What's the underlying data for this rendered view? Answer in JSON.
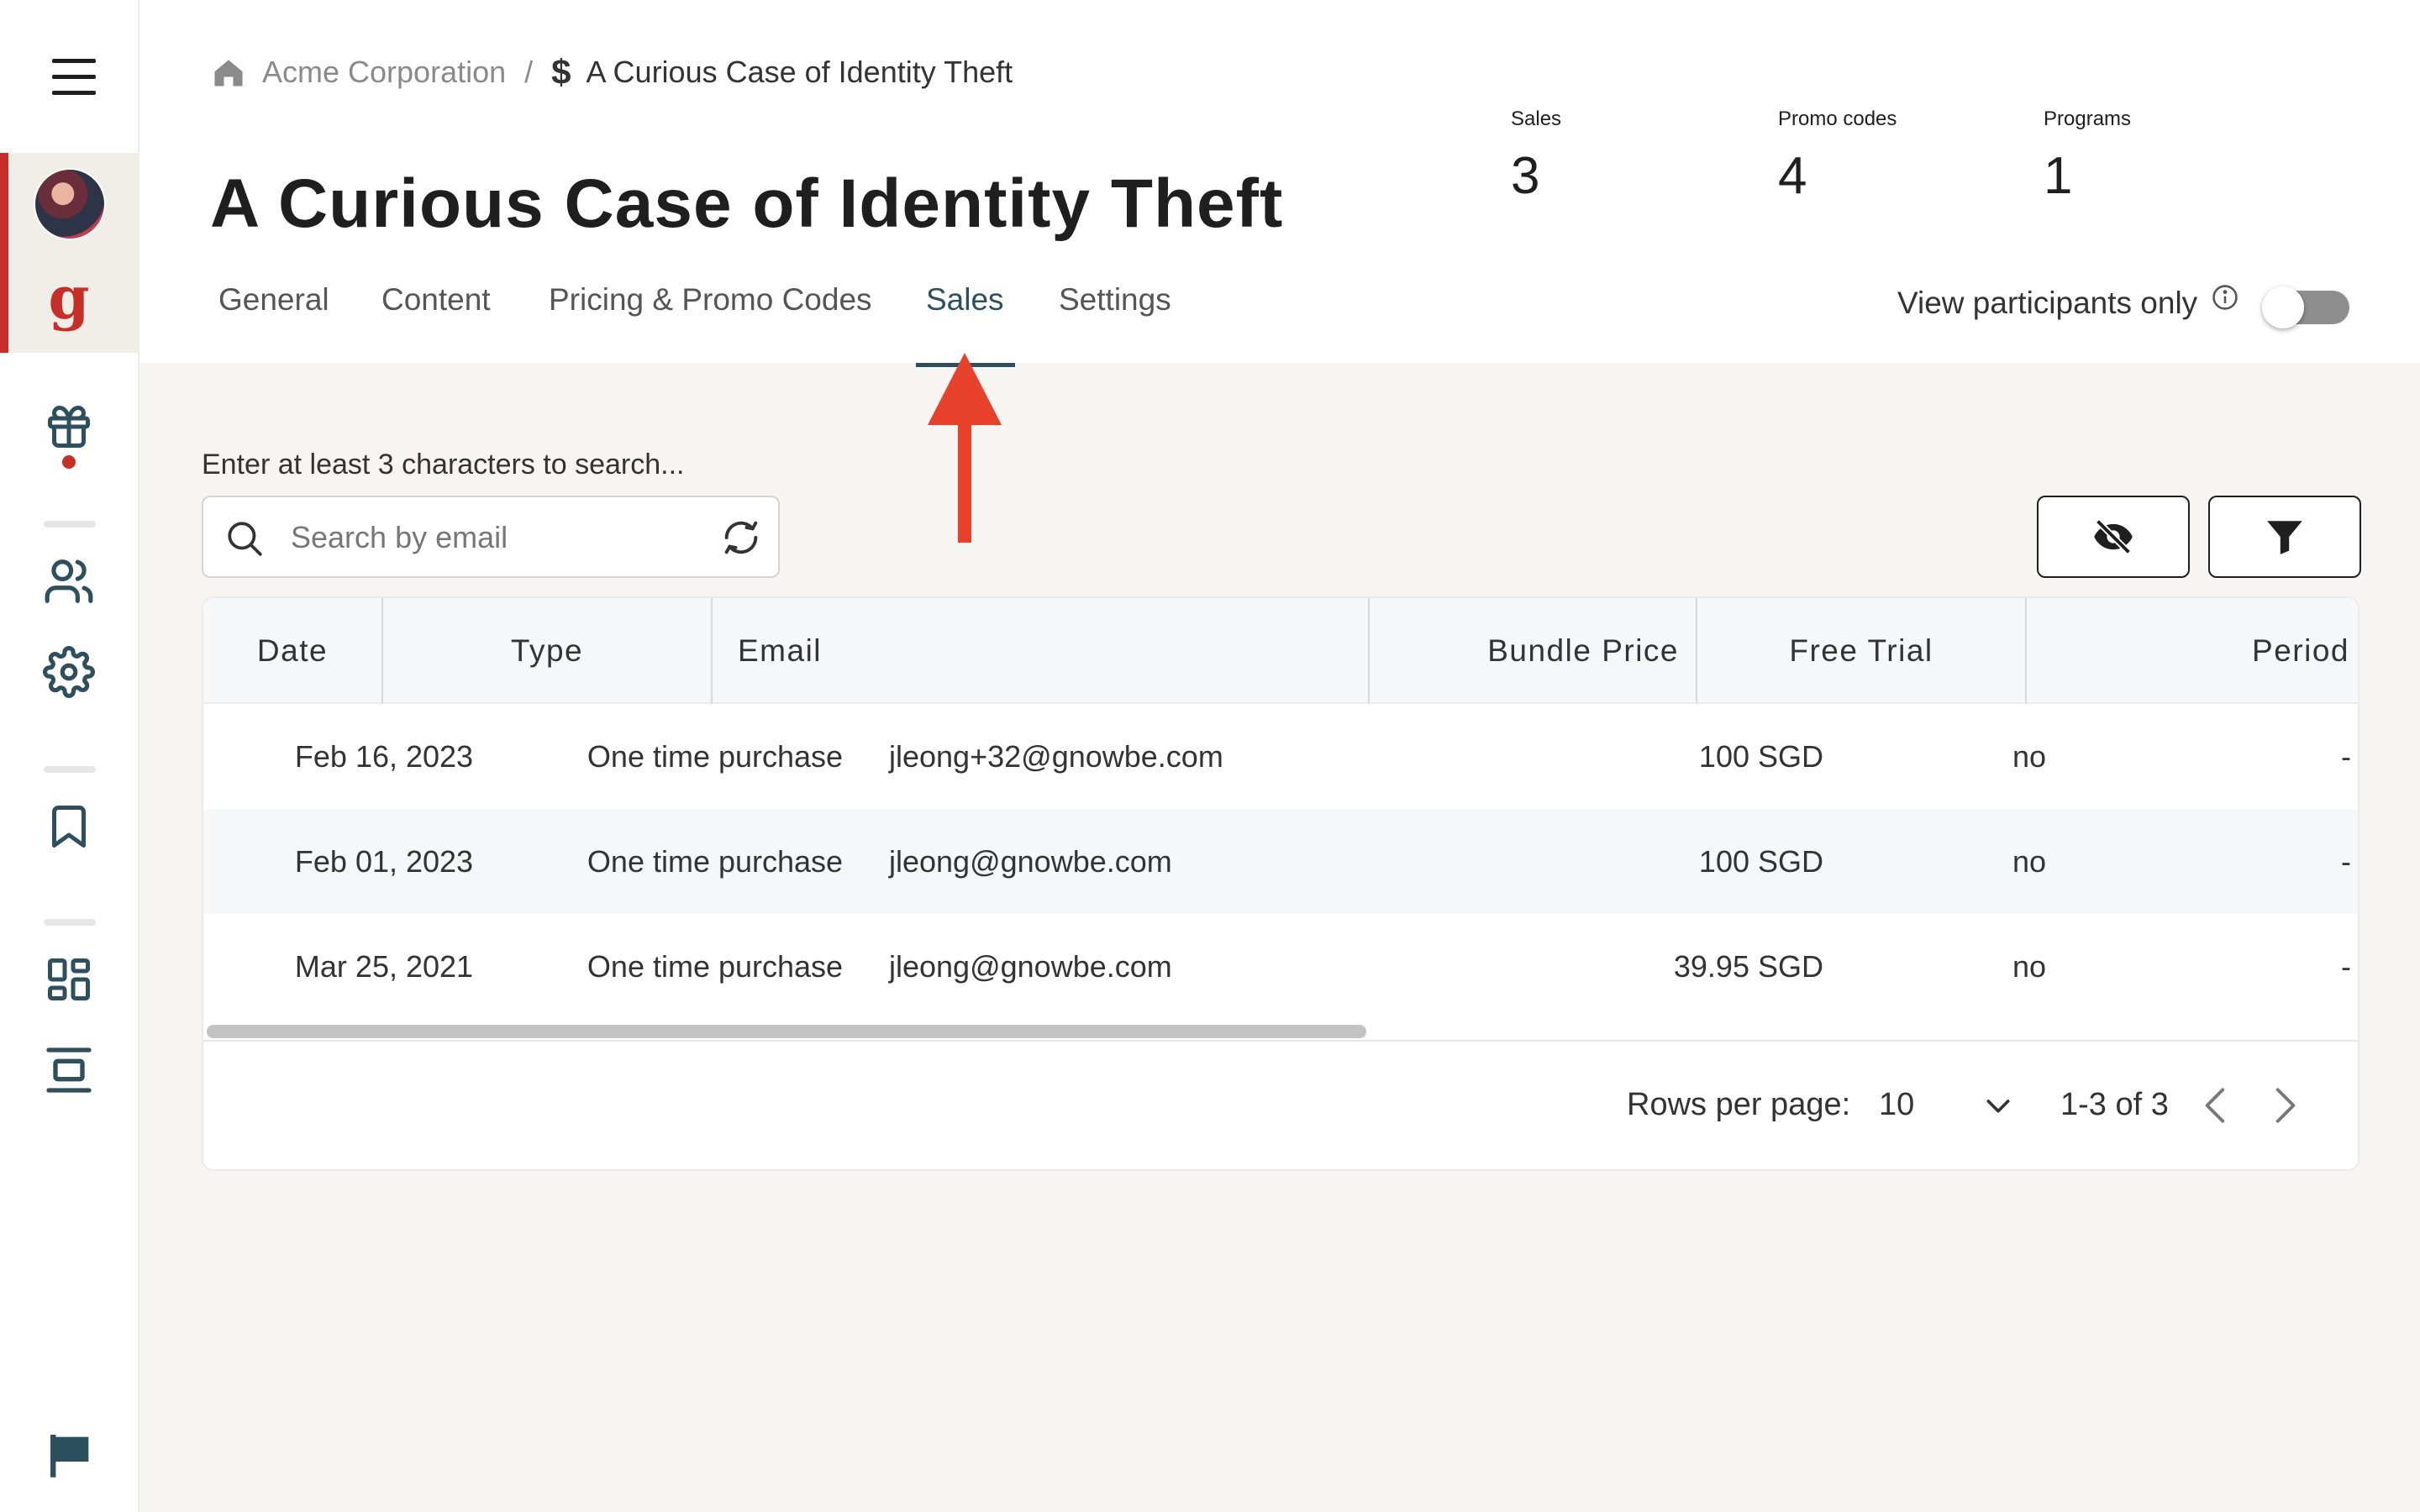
{
  "breadcrumb": {
    "org": "Acme Corporation",
    "separator": "/",
    "dollar": "$",
    "current": "A Curious Case of Identity Theft"
  },
  "page_title": "A Curious Case of Identity Theft",
  "stats": [
    {
      "label": "Sales",
      "value": "3"
    },
    {
      "label": "Promo codes",
      "value": "4"
    },
    {
      "label": "Programs",
      "value": "1"
    }
  ],
  "tabs": [
    {
      "label": "General"
    },
    {
      "label": "Content"
    },
    {
      "label": "Pricing & Promo Codes"
    },
    {
      "label": "Sales",
      "active": true
    },
    {
      "label": "Settings"
    }
  ],
  "participants_toggle": {
    "label": "View participants only",
    "on": false
  },
  "search": {
    "hint": "Enter at least 3 characters to search...",
    "placeholder": "Search by email",
    "value": ""
  },
  "table": {
    "columns": [
      "Date",
      "Type",
      "Email",
      "Bundle Price",
      "Free Trial",
      "Period"
    ],
    "rows": [
      {
        "date": "Feb 16, 2023",
        "type": "One time purchase",
        "email": "jleong+32@gnowbe.com",
        "price": "100 SGD",
        "trial": "no",
        "period": "-"
      },
      {
        "date": "Feb 01, 2023",
        "type": "One time purchase",
        "email": "jleong@gnowbe.com",
        "price": "100 SGD",
        "trial": "no",
        "period": "-"
      },
      {
        "date": "Mar 25, 2021",
        "type": "One time purchase",
        "email": "jleong@gnowbe.com",
        "price": "39.95 SGD",
        "trial": "no",
        "period": "-"
      }
    ]
  },
  "pagination": {
    "rows_per_page_label": "Rows per page:",
    "rows_per_page": "10",
    "range": "1-3 of 3"
  },
  "colors": {
    "accent": "#2d4f5e",
    "brand_red": "#c72e28",
    "annotation_arrow": "#e8412b"
  },
  "icons": {
    "sidebar": [
      "menu-icon",
      "avatar",
      "gnowbe-logo-icon",
      "gift-icon",
      "users-icon",
      "gear-icon",
      "bookmark-icon",
      "dashboard-icon",
      "layout-icon",
      "flag-icon"
    ]
  }
}
